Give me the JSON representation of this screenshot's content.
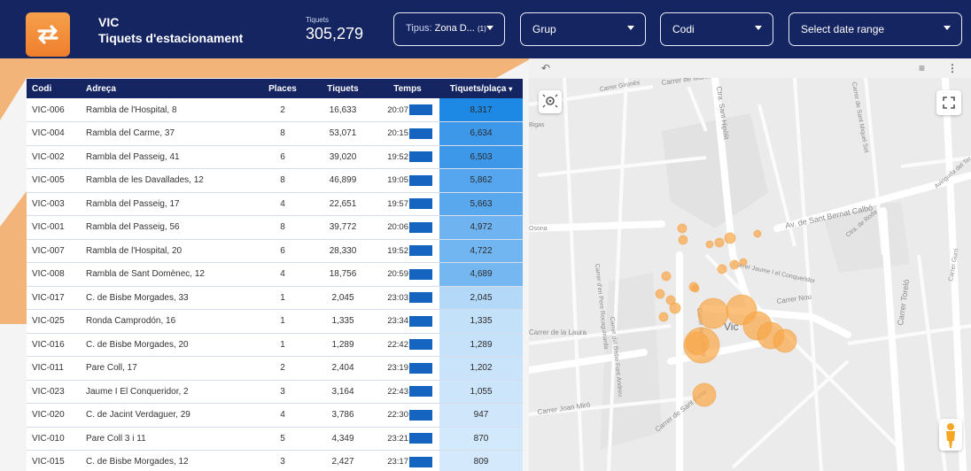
{
  "header": {
    "title": "VIC",
    "subtitle": "Tiquets d'estacionament",
    "kpi_label": "Tiquets",
    "kpi_value": "305,279"
  },
  "filters": {
    "tipus_label": "Tipus:",
    "tipus_value": "Zona D...",
    "tipus_count": "(1)",
    "grup": "Grup",
    "codi": "Codi",
    "date": "Select date range"
  },
  "colors": {
    "header_bg": "#152562",
    "accent_orange": "#ef7e2c",
    "bar_blue": "#1565c0"
  },
  "table": {
    "sort_indicator": "▾",
    "columns": [
      "Codi",
      "Adreça",
      "Places",
      "Tiquets",
      "Temps",
      "Tiquets/plaça"
    ],
    "rows": [
      {
        "codi": "VIC-006",
        "adreca": "Rambla de l'Hospital, 8",
        "places": "2",
        "tiquets": "16,633",
        "temps": "20:07",
        "tpp": "8,317"
      },
      {
        "codi": "VIC-004",
        "adreca": "Rambla del Carme, 37",
        "places": "8",
        "tiquets": "53,071",
        "temps": "20:15",
        "tpp": "6,634"
      },
      {
        "codi": "VIC-002",
        "adreca": "Rambla del Passeig, 41",
        "places": "6",
        "tiquets": "39,020",
        "temps": "19:52",
        "tpp": "6,503"
      },
      {
        "codi": "VIC-005",
        "adreca": "Rambla de les Davallades, 12",
        "places": "8",
        "tiquets": "46,899",
        "temps": "19:05",
        "tpp": "5,862"
      },
      {
        "codi": "VIC-003",
        "adreca": "Rambla del Passeig, 17",
        "places": "4",
        "tiquets": "22,651",
        "temps": "19:57",
        "tpp": "5,663"
      },
      {
        "codi": "VIC-001",
        "adreca": "Rambla del Passeig, 56",
        "places": "8",
        "tiquets": "39,772",
        "temps": "20:06",
        "tpp": "4,972"
      },
      {
        "codi": "VIC-007",
        "adreca": "Rambla de l'Hospital, 20",
        "places": "6",
        "tiquets": "28,330",
        "temps": "19:52",
        "tpp": "4,722"
      },
      {
        "codi": "VIC-008",
        "adreca": "Rambla de Sant Domènec, 12",
        "places": "4",
        "tiquets": "18,756",
        "temps": "20:59",
        "tpp": "4,689"
      },
      {
        "codi": "VIC-017",
        "adreca": "C. de Bisbe Morgades, 33",
        "places": "1",
        "tiquets": "2,045",
        "temps": "23:03",
        "tpp": "2,045"
      },
      {
        "codi": "VIC-025",
        "adreca": "Ronda Camprodón, 16",
        "places": "1",
        "tiquets": "1,335",
        "temps": "23:34",
        "tpp": "1,335"
      },
      {
        "codi": "VIC-016",
        "adreca": "C. de Bisbe Morgades, 20",
        "places": "1",
        "tiquets": "1,289",
        "temps": "22:42",
        "tpp": "1,289"
      },
      {
        "codi": "VIC-011",
        "adreca": "Pare Coll, 17",
        "places": "2",
        "tiquets": "2,404",
        "temps": "23:19",
        "tpp": "1,202"
      },
      {
        "codi": "VIC-023",
        "adreca": "Jaume I El Conqueridor, 2",
        "places": "3",
        "tiquets": "3,164",
        "temps": "22:43",
        "tpp": "1,055"
      },
      {
        "codi": "VIC-020",
        "adreca": "C. de Jacint Verdaguer, 29",
        "places": "4",
        "tiquets": "3,786",
        "temps": "22:30",
        "tpp": "947"
      },
      {
        "codi": "VIC-010",
        "adreca": "Pare Coll 3 i 11",
        "places": "5",
        "tiquets": "4,349",
        "temps": "23:21",
        "tpp": "870"
      },
      {
        "codi": "VIC-015",
        "adreca": "C. de Bisbe Morgades, 12",
        "places": "3",
        "tiquets": "2,427",
        "temps": "23:17",
        "tpp": "809"
      }
    ]
  },
  "map": {
    "city_label": "Vic",
    "street_labels": [
      "Ctra. Sant Hipòlit",
      "Av. de Sant Bernat Calbó",
      "Carrer Toreló",
      "Carrer Nou",
      "Carrer Jaume I el Conqueridor",
      "Carrer de la Laura",
      "Carrer Joan Miró",
      "Carrer de Sant Pere",
      "Carrer de Manlleu",
      "Carrer d'en Pere Rocaguinarda",
      "Carrer del Bisbe Font Andreu",
      "Carrer de la Riera",
      "Carrer Gironès",
      "Carrer de Sant Miquel Sot",
      "Osona",
      "Bigas",
      "Avinguda del Ter",
      "Ctra. de Roda",
      "Carrer Gurri"
    ],
    "icons": [
      "undo-icon",
      "filter-icon",
      "more-vert-icon",
      "locate-icon",
      "fullscreen-icon",
      "pegman-icon"
    ]
  }
}
